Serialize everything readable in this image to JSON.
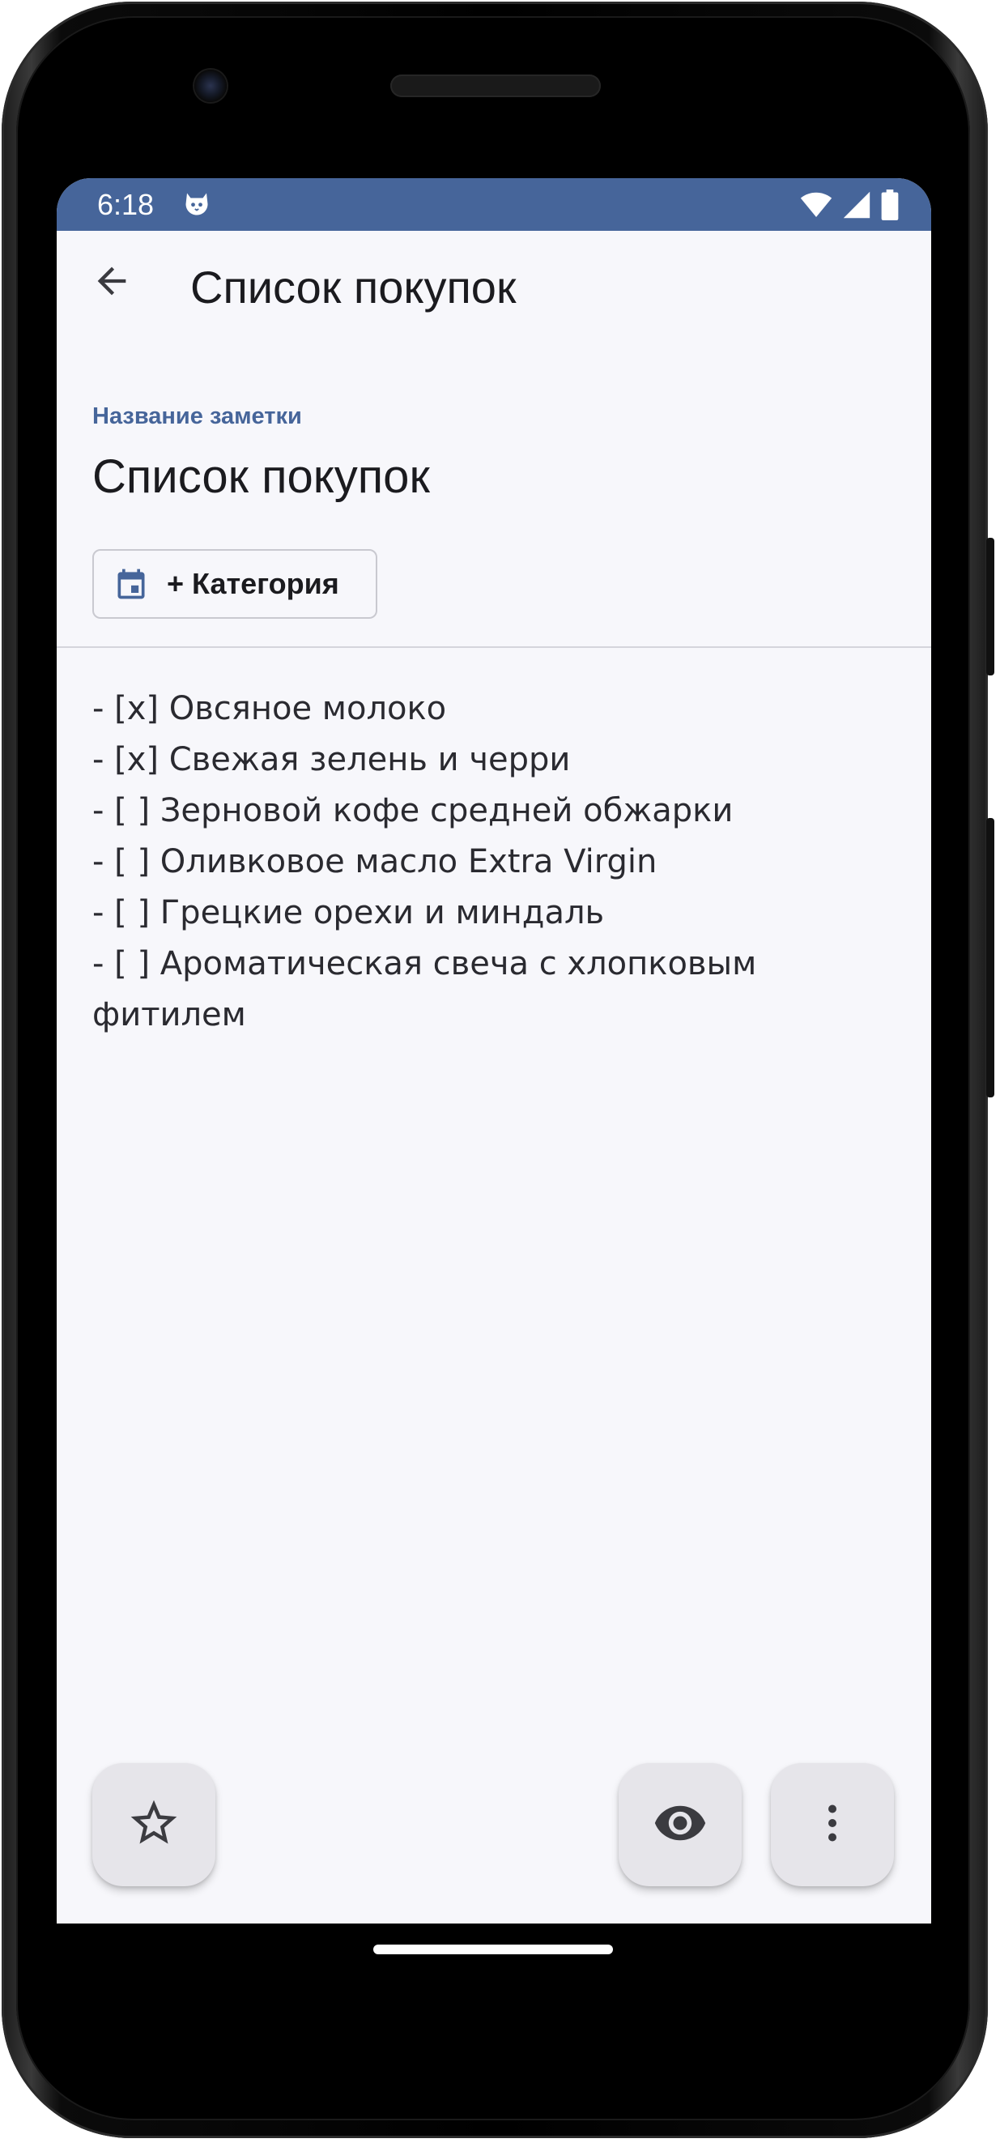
{
  "status_bar": {
    "time": "6:18",
    "icons": [
      "cat-notification-icon",
      "wifi-icon",
      "signal-icon",
      "battery-icon"
    ]
  },
  "topbar": {
    "title": "Список покупок",
    "back_icon": "arrow-back-icon"
  },
  "note": {
    "title_label": "Название заметки",
    "title_value": "Список покупок",
    "category_button": "+ Категория",
    "category_icon": "calendar-icon",
    "body": "- [x] Овсяное молоко\n- [x] Свежая зелень и черри\n- [ ] Зерновой кофе средней обжарки\n- [ ] Оливковое масло Extra Virgin\n- [ ] Грецкие орехи и миндаль\n- [ ] Ароматическая свеча с хлопковым\nфитилем"
  },
  "actions": {
    "favorite_icon": "star-outline-icon",
    "preview_icon": "eye-icon",
    "more_icon": "more-vertical-icon"
  },
  "colors": {
    "accent": "#46659a",
    "background": "#f7f7fb",
    "text": "#1b1b1f",
    "fab": "#e6e5ea"
  }
}
